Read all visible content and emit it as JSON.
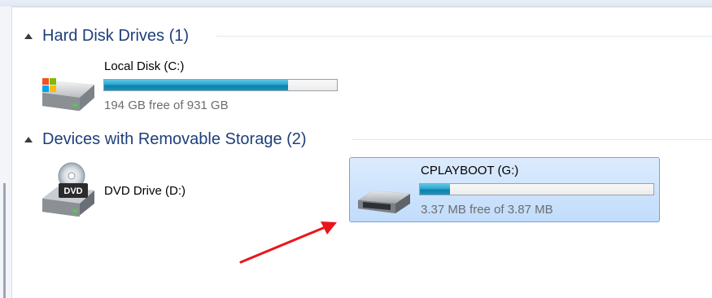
{
  "groups": [
    {
      "title": "Hard Disk Drives (1)"
    },
    {
      "title": "Devices with Removable Storage (2)"
    }
  ],
  "drives": {
    "local_disk": {
      "name": "Local Disk (C:)",
      "free_text": "194 GB free of 931 GB",
      "used_fraction": 0.79,
      "icon": "hard-drive-windows-icon"
    },
    "dvd_drive": {
      "name": "DVD Drive (D:)",
      "icon": "dvd-drive-icon",
      "icon_label": "DVD"
    },
    "usb_drive": {
      "name": "CPLAYBOOT (G:)",
      "free_text": "3.37 MB free of 3.87 MB",
      "used_fraction": 0.13,
      "icon": "usb-drive-icon",
      "selected": true
    }
  },
  "annotation": {
    "arrow_color": "#e8161b",
    "icon": "red-arrow-icon"
  },
  "colors": {
    "group_title": "#1e3f7a",
    "bar_fill": "#1a94c2",
    "selection_bg": "#c9e0fc"
  }
}
